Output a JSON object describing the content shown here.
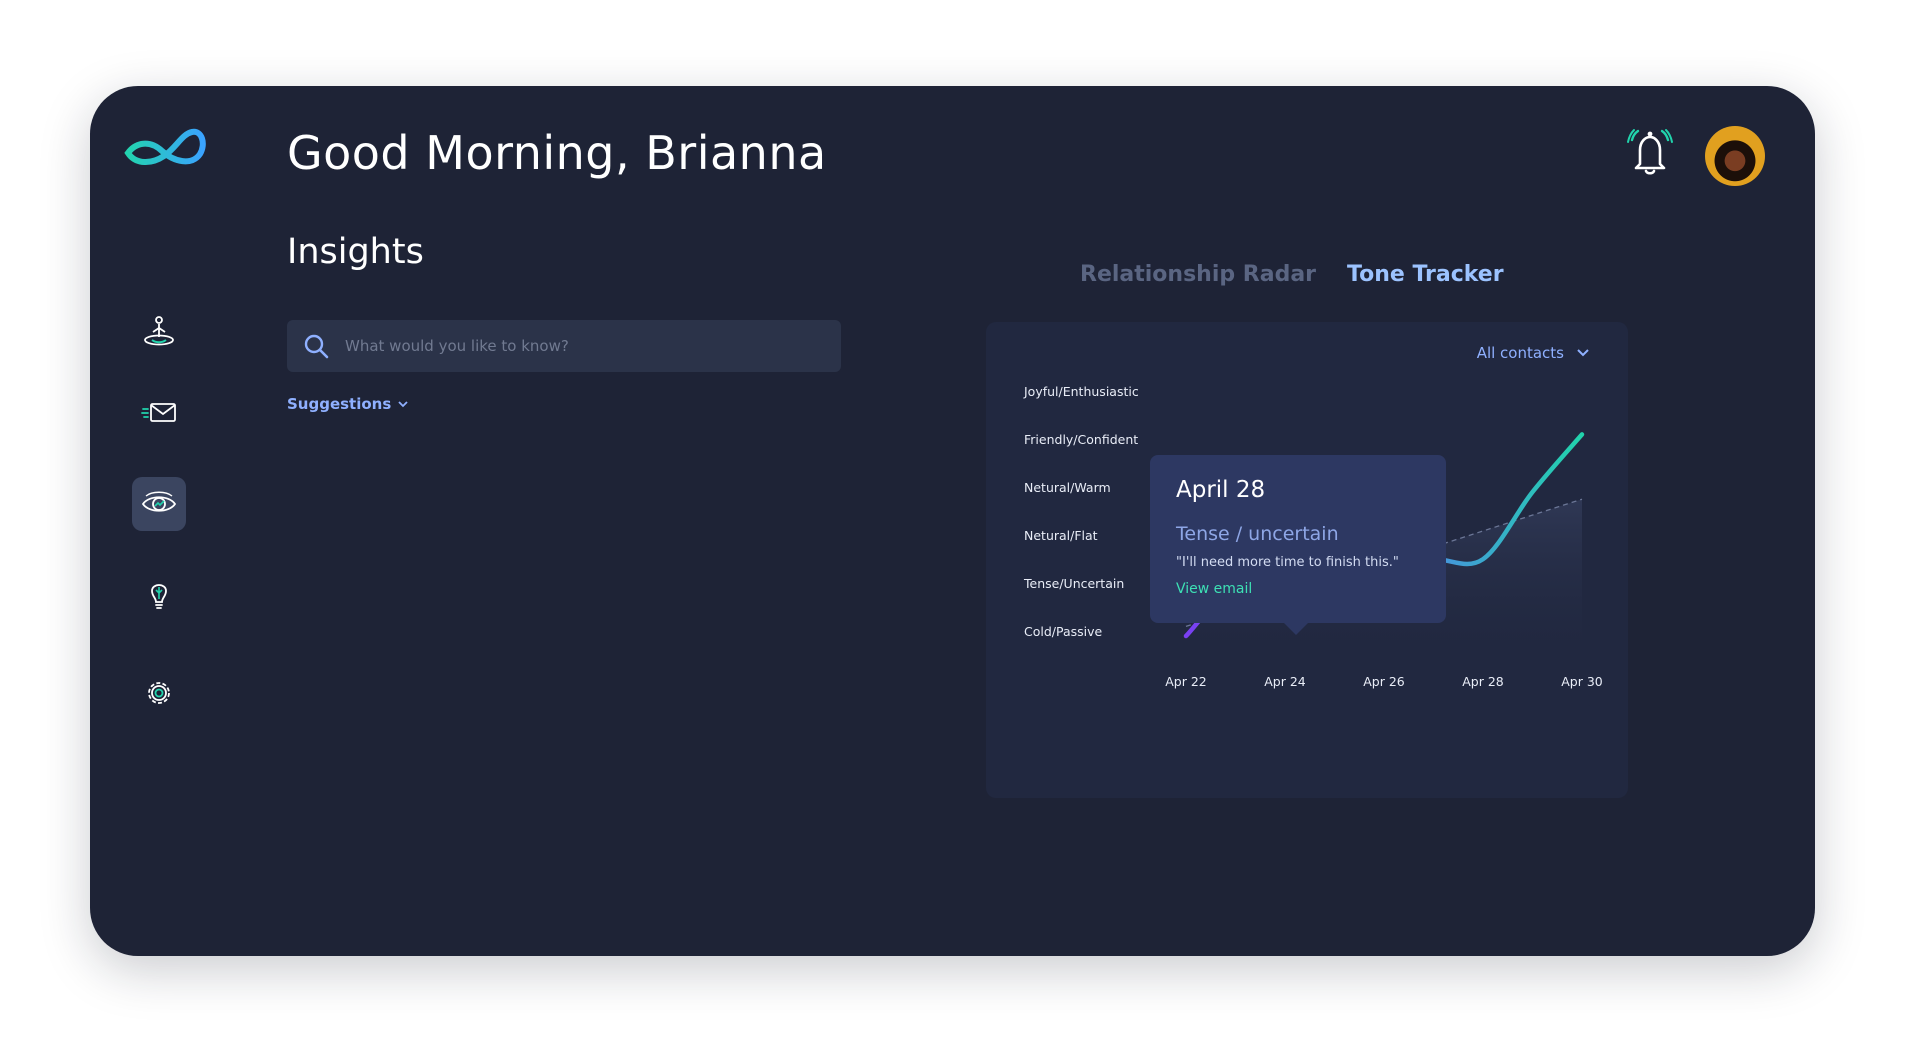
{
  "header": {
    "greeting": "Good Morning, Brianna"
  },
  "sidebar": {
    "items": [
      {
        "icon": "meditation-icon",
        "name": "nav-mindfulness"
      },
      {
        "icon": "send-mail-icon",
        "name": "nav-messages"
      },
      {
        "icon": "eye-icon",
        "name": "nav-insights",
        "active": true
      },
      {
        "icon": "lightbulb-icon",
        "name": "nav-ideas"
      },
      {
        "icon": "gear-icon",
        "name": "nav-settings"
      }
    ]
  },
  "main": {
    "title": "Insights",
    "search": {
      "placeholder": "What would you like to know?"
    },
    "suggestions_label": "Suggestions"
  },
  "tabs": [
    {
      "label": "Relationship Radar",
      "active": false
    },
    {
      "label": "Tone Tracker",
      "active": true
    }
  ],
  "tone_tracker": {
    "filter_label": "All contacts",
    "tooltip": {
      "date": "April 28",
      "tone": "Tense / uncertain",
      "quote": "\"I'll need more time to finish this.\"",
      "link_label": "View email"
    }
  },
  "chart_data": {
    "type": "line",
    "y_categories": [
      "Joyful/Enthusiastic",
      "Friendly/Confident",
      "Netural/Warm",
      "Netural/Flat",
      "Tense/Uncertain",
      "Cold/Passive"
    ],
    "x_tick_labels": [
      "Apr 22",
      "Apr 24",
      "Apr 26",
      "Apr 28",
      "Apr 30"
    ],
    "series": [
      {
        "points": [
          {
            "x": "Apr 22",
            "y": 0.0
          },
          {
            "x": "Apr 23",
            "y": 1.0
          },
          {
            "x": "Apr 24",
            "y": 0.6
          },
          {
            "x": "Apr 25",
            "y": 1.2
          },
          {
            "x": "Apr 26",
            "y": 1.5
          },
          {
            "x": "Apr 27",
            "y": 1.6
          },
          {
            "x": "Apr 28",
            "y": 1.6
          },
          {
            "x": "Apr 29",
            "y": 3.0
          },
          {
            "x": "Apr 30",
            "y": 4.2
          }
        ],
        "highlight_x": "Apr 24"
      }
    ],
    "trend": {
      "start": 0.2,
      "end": 2.85
    },
    "colors": {
      "start": "#7a3ff2",
      "mid": "#4f86e8",
      "end": "#21d3ac"
    },
    "ylim": [
      0,
      5
    ]
  },
  "colors": {
    "background": "#1e2336",
    "accent": "#9cc3ff",
    "teal": "#3de0b4"
  }
}
